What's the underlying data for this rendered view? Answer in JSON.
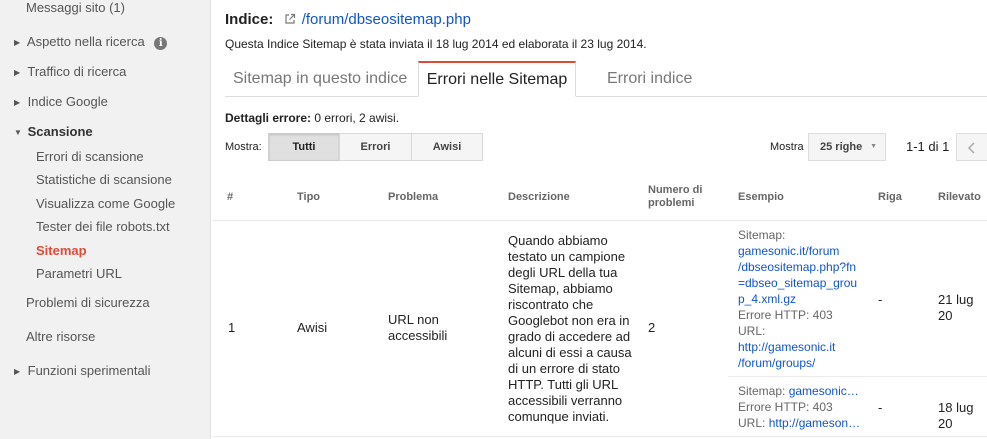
{
  "sidebar": {
    "top_item": "Messaggi sito (1)",
    "items": [
      {
        "label": "Aspetto nella ricerca"
      },
      {
        "label": "Traffico di ricerca"
      },
      {
        "label": "Indice Google"
      },
      {
        "label": "Scansione"
      }
    ],
    "sub_items": [
      "Errori di scansione",
      "Statistiche di scansione",
      "Visualizza come Google",
      "Tester dei file robots.txt",
      "Sitemap",
      "Parametri URL"
    ],
    "bottom_items": [
      "Problemi di sicurezza",
      "Altre risorse",
      "Funzioni sperimentali"
    ]
  },
  "header": {
    "index_label": "Indice:",
    "index_path": "/forum/dbseositemap.php",
    "submitted_text": "Questa Indice Sitemap è stata inviata il 18 lug 2014 ed elaborata il 23 lug 2014."
  },
  "tabs": [
    {
      "label": "Sitemap in questo indice"
    },
    {
      "label": "Errori nelle Sitemap"
    },
    {
      "label": "Errori indice"
    }
  ],
  "details": {
    "label": "Dettagli errore:",
    "summary": " 0 errori, 2 awisi."
  },
  "filter": {
    "show_label": "Mostra:",
    "options": [
      "Tutti",
      "Errori",
      "Awisi"
    ],
    "rows_label": "Mostra",
    "rows_value": "25 righe",
    "pagination": "1-1 di 1"
  },
  "table": {
    "headers": {
      "num": "#",
      "type": "Tipo",
      "problem": "Problema",
      "description": "Descrizione",
      "count_1": "Numero di",
      "count_2": "problemi",
      "example": "Esempio",
      "line": "Riga",
      "detected": "Rilevato"
    },
    "row": {
      "num": "1",
      "type": "Awisi",
      "problem_1": "URL non",
      "problem_2": "accessibili",
      "description": "Quando abbiamo testato un campione degli URL della tua Sitemap, abbiamo riscontrato che Googlebot non era in grado di accedere ad alcuni di essi a causa di un errore di stato HTTP. Tutti gli URL accessibili verranno comunque inviati.",
      "count": "2"
    },
    "examples": [
      {
        "sitemap_label": "Sitemap:",
        "sitemap_lines": [
          "gamesonic.it/forum",
          "/dbseositemap.php?fn",
          "=dbseo_sitemap_grou",
          "p_4.xml.gz"
        ],
        "http_label": "Errore HTTP: 403",
        "url_label": "URL:",
        "url_lines": [
          "http://gamesonic.it",
          "/forum/groups/"
        ],
        "line": "-",
        "detected": "21 lug 20"
      },
      {
        "sitemap_label": "Sitemap: ",
        "sitemap_short": "gamesonic…",
        "http_label": "Errore HTTP: 403",
        "url_label": "URL: ",
        "url_short": "http://gameson…",
        "line": "-",
        "detected": "18 lug 20"
      }
    ]
  }
}
